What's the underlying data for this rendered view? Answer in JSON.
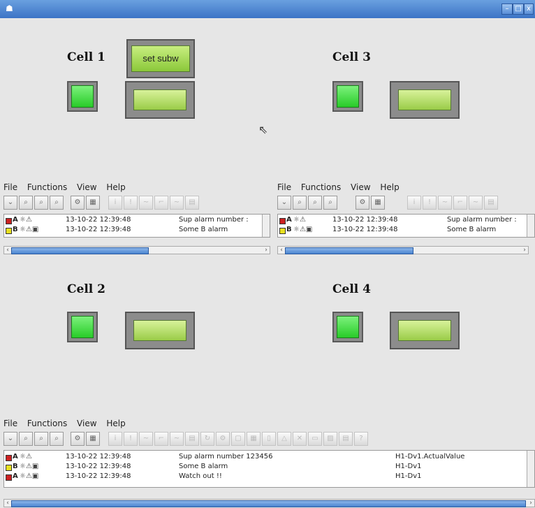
{
  "window": {
    "title": "",
    "icon": "person-icon",
    "buttons": [
      "minimize",
      "maximize",
      "close"
    ]
  },
  "cells": [
    {
      "caption": "Cell 1"
    },
    {
      "caption": "Cell 3"
    },
    {
      "caption": "Cell 2"
    },
    {
      "caption": "Cell 4"
    }
  ],
  "set_subw_label": "set subw",
  "menu": {
    "file": "File",
    "functions": "Functions",
    "view": "View",
    "help": "Help"
  },
  "alarms": [
    {
      "prio": "A",
      "prio_color": "#cc2222",
      "time": "13-10-22 12:39:48",
      "text": "Sup alarm number 123456",
      "object": "H1-Dv1.ActualValue"
    },
    {
      "prio": "B",
      "prio_color": "#e8e020",
      "time": "13-10-22 12:39:48",
      "text": "Some B alarm",
      "object": "H1-Dv1"
    },
    {
      "prio": "A",
      "prio_color": "#cc2222",
      "time": "13-10-22 12:39:48",
      "text": "Watch out !!",
      "object": "H1-Dv1"
    }
  ],
  "small_pane_texts": {
    "row1": "Sup alarm number :",
    "row2": "Some B alarm"
  },
  "colors": {
    "titlebar": "#3c74c6",
    "green": "#28cc28",
    "lightgreen": "#9acc48"
  }
}
